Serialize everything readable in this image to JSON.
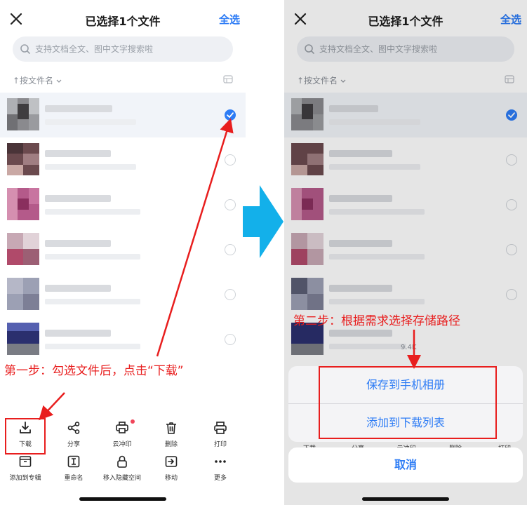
{
  "left_screen": {
    "header": {
      "title": "已选择1个文件",
      "select_all": "全选"
    },
    "search": {
      "placeholder": "支持文档全文、图中文字搜索啦"
    },
    "sort": {
      "label": "↑按文件名"
    },
    "toolbar": {
      "row1": [
        {
          "label": "下载",
          "icon": "download-icon"
        },
        {
          "label": "分享",
          "icon": "share-icon"
        },
        {
          "label": "云冲印",
          "icon": "printer-icon"
        },
        {
          "label": "删除",
          "icon": "trash-icon"
        },
        {
          "label": "打印",
          "icon": "print-icon"
        }
      ],
      "row2": [
        {
          "label": "添加到专辑",
          "icon": "album-icon"
        },
        {
          "label": "重命名",
          "icon": "rename-icon"
        },
        {
          "label": "移入隐藏空间",
          "icon": "lock-icon"
        },
        {
          "label": "移动",
          "icon": "move-icon"
        },
        {
          "label": "更多",
          "icon": "more-icon"
        }
      ]
    }
  },
  "right_screen": {
    "header": {
      "title": "已选择1个文件",
      "select_all": "全选"
    },
    "search": {
      "placeholder": "支持文档全文、图中文字搜索啦"
    },
    "sort": {
      "label": "↑按文件名"
    },
    "sheet": {
      "option1": "保存到手机相册",
      "option2": "添加到下载列表",
      "cancel": "取消"
    },
    "partial_meta": "9.4K",
    "toolbar_labels": [
      "下载",
      "分享",
      "云冲印",
      "删除",
      "打印"
    ]
  },
  "annotations": {
    "step1": "第一步：勾选文件后，点击“下载”",
    "step2": "第二步：根据需求选择存储路径"
  },
  "files": [
    {
      "selected": true
    },
    {
      "selected": false
    },
    {
      "selected": false
    },
    {
      "selected": false
    },
    {
      "selected": false
    },
    {
      "selected": false
    }
  ],
  "colors": {
    "accent": "#2d7cf5",
    "annotation": "#e81e1e",
    "step_arrow": "#13b0ea"
  }
}
